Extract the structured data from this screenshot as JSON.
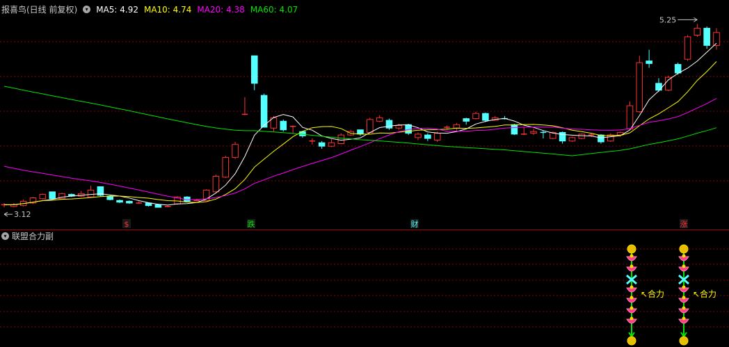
{
  "header": {
    "title": "报喜鸟(日线 前复权)",
    "ma5": "MA5: 4.92",
    "ma10": "MA10: 4.74",
    "ma20": "MA20: 4.38",
    "ma60": "MA60: 4.07"
  },
  "sub_panel": {
    "title": "联盟合力副",
    "signal_label": "↖合力"
  },
  "colors": {
    "up": "#ff3232",
    "down": "#54ffff",
    "ma5": "#ffffff",
    "ma10": "#ffff00",
    "ma20": "#ff00ff",
    "ma60": "#00e600",
    "grid": "#8b0000"
  },
  "chart_data": {
    "type": "candlestick",
    "title": "报喜鸟(日线 前复权)",
    "ylim": [
      3.0,
      5.35
    ],
    "candles": [
      [
        3.14,
        3.15,
        3.17,
        3.12
      ],
      [
        3.13,
        3.15,
        3.17,
        3.12
      ],
      [
        3.14,
        3.19,
        3.21,
        3.13
      ],
      [
        3.17,
        3.23,
        3.24,
        3.16
      ],
      [
        3.22,
        3.27,
        3.28,
        3.21
      ],
      [
        3.3,
        3.22,
        3.3,
        3.21
      ],
      [
        3.22,
        3.28,
        3.29,
        3.21
      ],
      [
        3.27,
        3.25,
        3.28,
        3.24
      ],
      [
        3.25,
        3.28,
        3.31,
        3.24
      ],
      [
        3.24,
        3.32,
        3.37,
        3.23
      ],
      [
        3.36,
        3.26,
        3.36,
        3.25
      ],
      [
        3.25,
        3.21,
        3.26,
        3.2
      ],
      [
        3.2,
        3.18,
        3.21,
        3.17
      ],
      [
        3.19,
        3.17,
        3.2,
        3.16
      ],
      [
        3.17,
        3.17,
        3.19,
        3.16
      ],
      [
        3.17,
        3.14,
        3.17,
        3.13
      ],
      [
        3.15,
        3.12,
        3.16,
        3.12
      ],
      [
        3.13,
        3.13,
        3.14,
        3.12
      ],
      [
        3.16,
        3.24,
        3.25,
        3.15
      ],
      [
        3.24,
        3.19,
        3.25,
        3.19
      ],
      [
        3.19,
        3.2,
        3.22,
        3.19
      ],
      [
        3.2,
        3.32,
        3.33,
        3.2
      ],
      [
        3.3,
        3.48,
        3.5,
        3.29
      ],
      [
        3.47,
        3.7,
        3.72,
        3.46
      ],
      [
        3.7,
        3.85,
        3.88,
        3.68
      ],
      [
        4.19,
        4.2,
        4.4,
        4.19
      ],
      [
        4.88,
        4.56,
        4.88,
        4.48
      ],
      [
        4.42,
        4.05,
        4.44,
        4.05
      ],
      [
        4.04,
        4.16,
        4.18,
        4.0
      ],
      [
        4.12,
        4.02,
        4.14,
        4.0
      ],
      [
        4.06,
        4.06,
        4.07,
        3.98
      ],
      [
        4.0,
        3.95,
        4.01,
        3.93
      ],
      [
        3.88,
        3.89,
        3.92,
        3.85
      ],
      [
        3.87,
        3.83,
        3.89,
        3.8
      ],
      [
        3.83,
        3.87,
        3.91,
        3.82
      ],
      [
        3.86,
        3.96,
        3.98,
        3.86
      ],
      [
        3.96,
        4.0,
        4.02,
        3.95
      ],
      [
        4.02,
        3.97,
        4.02,
        3.95
      ],
      [
        3.99,
        4.14,
        4.16,
        3.98
      ],
      [
        4.12,
        4.16,
        4.19,
        4.11
      ],
      [
        4.13,
        4.04,
        4.15,
        4.02
      ],
      [
        4.04,
        4.07,
        4.09,
        4.02
      ],
      [
        4.08,
        3.98,
        4.09,
        3.96
      ],
      [
        3.93,
        3.97,
        3.99,
        3.9
      ],
      [
        3.96,
        3.92,
        3.98,
        3.89
      ],
      [
        3.9,
        3.98,
        4.0,
        3.88
      ],
      [
        4.05,
        4.05,
        4.07,
        4.02
      ],
      [
        4.04,
        4.08,
        4.1,
        4.01
      ],
      [
        4.15,
        4.12,
        4.16,
        4.08
      ],
      [
        4.15,
        4.21,
        4.23,
        4.14
      ],
      [
        4.21,
        4.13,
        4.22,
        4.11
      ],
      [
        4.13,
        4.16,
        4.18,
        4.13
      ],
      [
        4.15,
        4.14,
        4.18,
        4.14
      ],
      [
        4.08,
        3.97,
        4.09,
        3.96
      ],
      [
        3.96,
        3.97,
        4.05,
        3.96
      ],
      [
        3.98,
        4.0,
        4.03,
        3.96
      ],
      [
        3.99,
        3.98,
        4.01,
        3.92
      ],
      [
        3.92,
        3.99,
        4.0,
        3.91
      ],
      [
        3.99,
        3.89,
        4.0,
        3.86
      ],
      [
        3.89,
        3.93,
        3.94,
        3.88
      ],
      [
        3.92,
        3.97,
        3.98,
        3.91
      ],
      [
        3.96,
        3.96,
        3.98,
        3.94
      ],
      [
        3.96,
        3.88,
        3.97,
        3.86
      ],
      [
        3.89,
        3.96,
        3.98,
        3.88
      ],
      [
        3.96,
        3.99,
        4.0,
        3.94
      ],
      [
        4.03,
        4.3,
        4.35,
        4.02
      ],
      [
        4.23,
        4.8,
        4.88,
        4.22
      ],
      [
        4.82,
        4.79,
        4.95,
        4.74
      ],
      [
        4.56,
        4.48,
        4.62,
        4.46
      ],
      [
        4.48,
        4.63,
        4.65,
        4.47
      ],
      [
        4.78,
        4.68,
        4.8,
        4.66
      ],
      [
        4.84,
        5.1,
        5.12,
        4.82
      ],
      [
        5.12,
        5.2,
        5.25,
        5.1
      ],
      [
        5.2,
        5.0,
        5.22,
        4.96
      ],
      [
        5.0,
        5.15,
        5.2,
        4.95
      ]
    ],
    "ma": {
      "MA5": "4.92",
      "MA10": "4.74",
      "MA20": "4.38",
      "MA60": "4.07"
    },
    "annotations": {
      "high": "5.25",
      "low": "3.12"
    },
    "signals": [
      {
        "label": "$",
        "color": "#ff3232"
      },
      {
        "label": "跌",
        "color": "#00e600"
      },
      {
        "label": "财",
        "color": "#54ffff"
      },
      {
        "label": "涨",
        "color": "#ff3232"
      }
    ]
  }
}
